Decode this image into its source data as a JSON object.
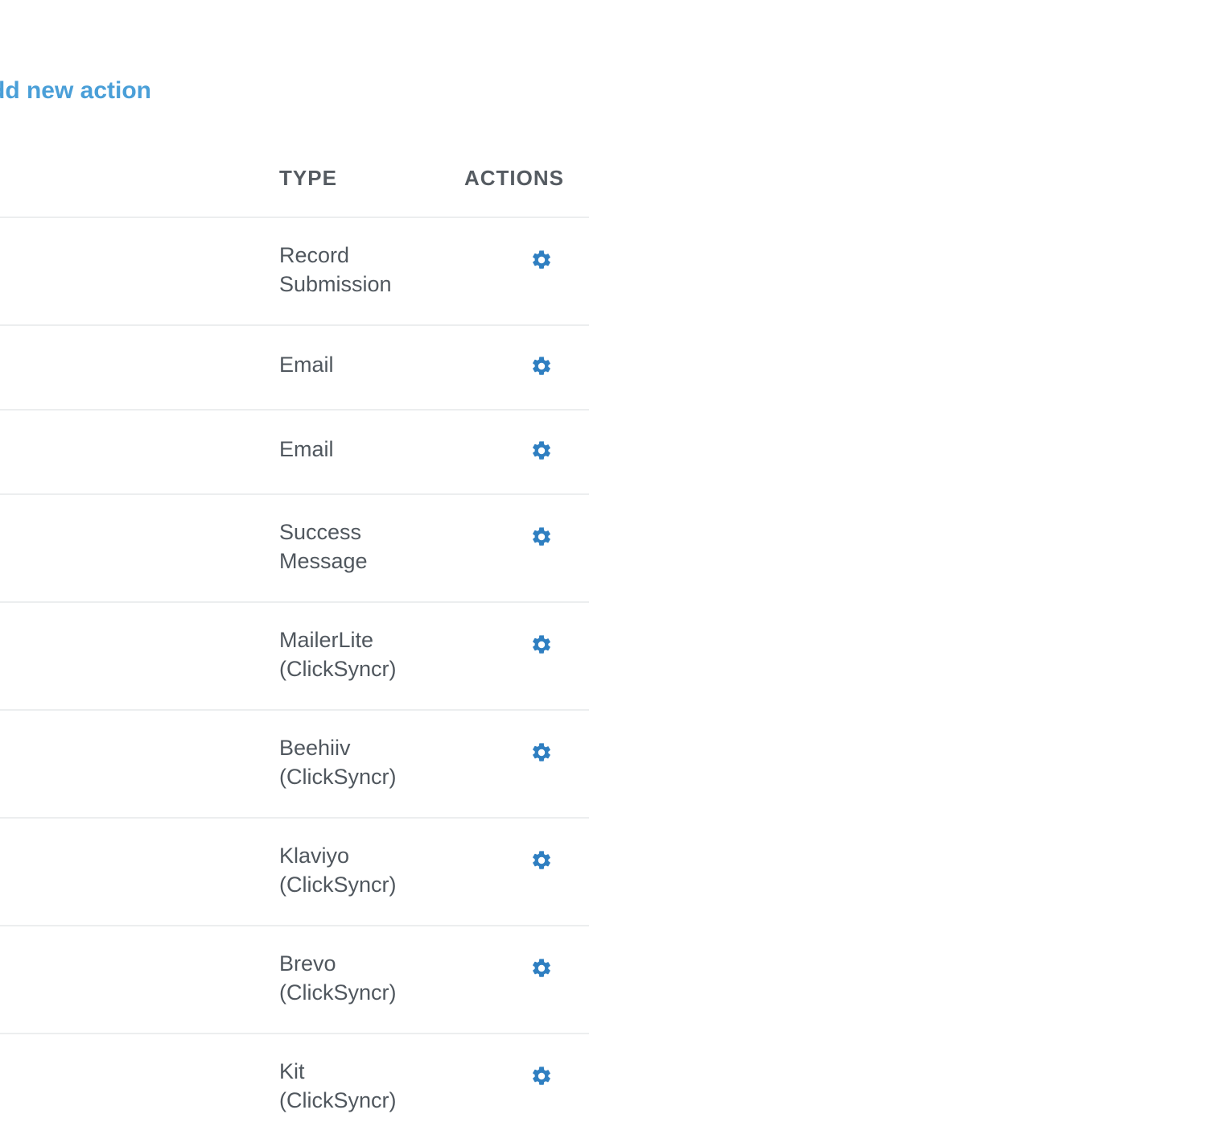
{
  "toolbar": {
    "add_action_label": "dd new action"
  },
  "table": {
    "columns": {
      "type": "TYPE",
      "actions": "ACTIONS"
    },
    "rows": [
      {
        "type": "Record\nSubmission",
        "action_icon": "gear-icon"
      },
      {
        "type": "Email",
        "action_icon": "gear-icon"
      },
      {
        "type": "Email",
        "action_icon": "gear-icon"
      },
      {
        "type": "Success\nMessage",
        "action_icon": "gear-icon"
      },
      {
        "type": "MailerLite\n(ClickSyncr)",
        "action_icon": "gear-icon"
      },
      {
        "type": "Beehiiv\n(ClickSyncr)",
        "action_icon": "gear-icon"
      },
      {
        "type": "Klaviyo\n(ClickSyncr)",
        "action_icon": "gear-icon"
      },
      {
        "type": "Brevo\n(ClickSyncr)",
        "action_icon": "gear-icon"
      },
      {
        "type": "Kit\n(ClickSyncr)",
        "action_icon": "gear-icon"
      }
    ]
  },
  "colors": {
    "link": "#4a9fd8",
    "gear": "#2f7fc1",
    "text": "#50575e",
    "divider": "#eceeef"
  }
}
